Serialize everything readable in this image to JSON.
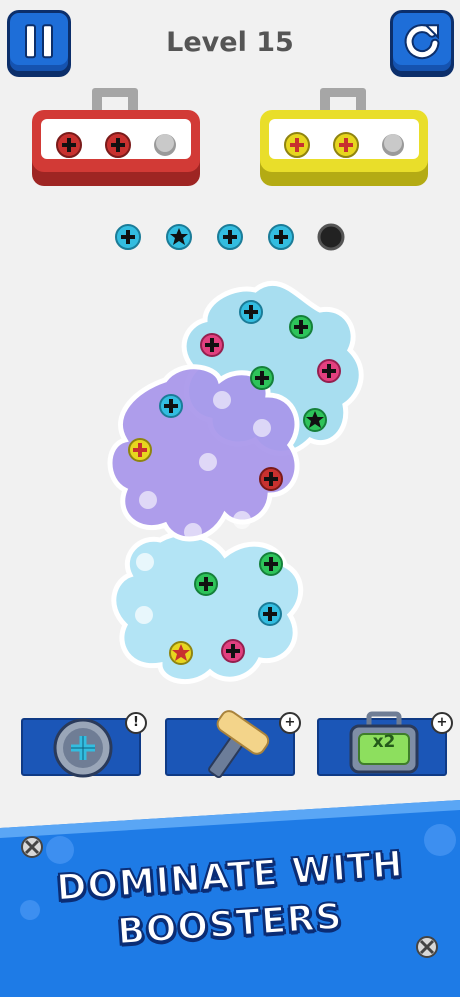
{
  "header": {
    "level_title": "Level 15",
    "pause_icon": "pause-icon",
    "restart_icon": "restart-icon"
  },
  "toolboxes": [
    {
      "color": "#d23a36",
      "screws": [
        "#c8312f",
        "#c8312f"
      ],
      "empty_holes": 1
    },
    {
      "color": "#e9de2a",
      "screws": [
        "#e7d61f",
        "#e7d61f"
      ],
      "empty_holes": 1
    }
  ],
  "holding_slots": [
    {
      "color": "#33bde0",
      "mark": "plus"
    },
    {
      "color": "#33bde0",
      "mark": "star"
    },
    {
      "color": "#33bde0",
      "mark": "plus"
    },
    {
      "color": "#33bde0",
      "mark": "plus"
    },
    {
      "color": "#222222",
      "mark": "empty"
    }
  ],
  "boosters": [
    {
      "name": "screw-booster",
      "icon": "screw-icon",
      "badge": "!"
    },
    {
      "name": "hammer-booster",
      "icon": "hammer-icon",
      "badge": "+"
    },
    {
      "name": "extra-box-booster",
      "icon": "toolbox-icon",
      "label": "x2",
      "badge": "+"
    }
  ],
  "banner": {
    "line1": "DOMINATE WITH",
    "line2": "BOOSTERS",
    "background_color": "#1e7be6"
  }
}
